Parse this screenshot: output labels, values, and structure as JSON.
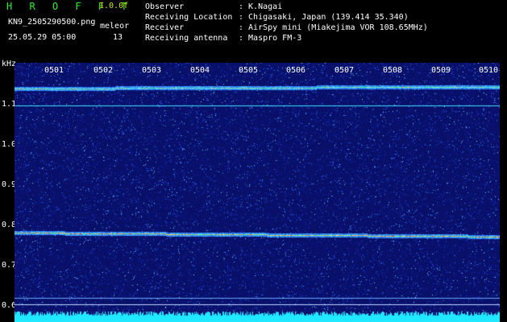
{
  "header": {
    "app_title": "H R O F F T",
    "version": "1.0.0f",
    "filename": "KN9_2505290500.png",
    "mode": "meleor",
    "datetime": "25.05.29 05:00",
    "count": "13",
    "meta": [
      {
        "label": "Observer",
        "value": ": K.Nagai"
      },
      {
        "label": "Receiving Location",
        "value": ": Chigasaki, Japan (139.414 35.340)"
      },
      {
        "label": "Receiver",
        "value": ": AirSpy mini (Miakejima VOR 108.65MHz)"
      },
      {
        "label": "Receiving antenna",
        "value": ": Maspro FM-3"
      }
    ]
  },
  "axis": {
    "unit": "kHz",
    "y_labels": [
      "1.1",
      "1.0",
      "0.9",
      "0.8",
      "0.7",
      "0.6"
    ],
    "time_labels": [
      "0501",
      "0502",
      "0503",
      "0504",
      "0505",
      "0506",
      "0507",
      "0508",
      "0509",
      "0510"
    ]
  },
  "colors": {
    "background": "#000000",
    "title": "#29f029",
    "version": "#d8e000",
    "waterfall_base": "#08106a",
    "carrier_cyan": "#40e0ff",
    "noise_floor": "#20e8ff"
  }
}
